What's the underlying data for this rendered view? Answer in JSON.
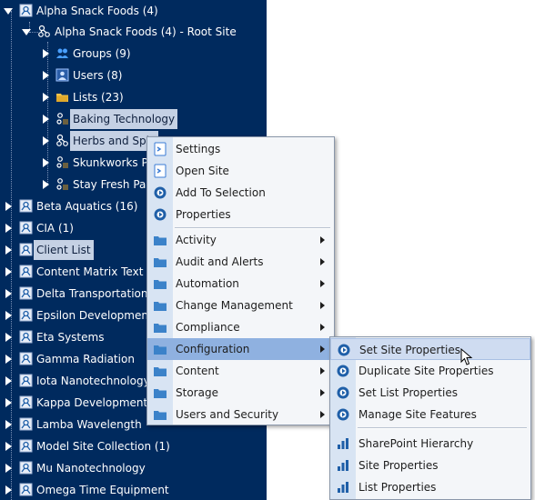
{
  "tree": {
    "items": [
      {
        "label": "Alpha Snack Foods (4)"
      },
      {
        "label": "Alpha Snack Foods (4) - Root Site"
      },
      {
        "label": "Groups (9)"
      },
      {
        "label": "Users (8)"
      },
      {
        "label": "Lists (23)"
      },
      {
        "label": "Baking Technology"
      },
      {
        "label": "Herbs and Spic"
      },
      {
        "label": "Skunkworks Pro"
      },
      {
        "label": "Stay Fresh Pacl"
      },
      {
        "label": "Beta Aquatics (16)"
      },
      {
        "label": "CIA (1)"
      },
      {
        "label": "Client List"
      },
      {
        "label": "Content Matrix Text"
      },
      {
        "label": "Delta Transportation"
      },
      {
        "label": "Epsilon Development"
      },
      {
        "label": "Eta Systems"
      },
      {
        "label": "Gamma Radiation"
      },
      {
        "label": "Iota Nanotechnology"
      },
      {
        "label": "Kappa Development"
      },
      {
        "label": "Lamba Wavelength"
      },
      {
        "label": "Model Site Collection (1)"
      },
      {
        "label": "Mu Nanotechnology"
      },
      {
        "label": "Omega Time Equipment"
      }
    ]
  },
  "context_menu": {
    "items": [
      {
        "label": "Settings"
      },
      {
        "label": "Open Site"
      },
      {
        "label": "Add To Selection"
      },
      {
        "label": "Properties"
      },
      {
        "label": "Activity"
      },
      {
        "label": "Audit and Alerts"
      },
      {
        "label": "Automation"
      },
      {
        "label": "Change Management"
      },
      {
        "label": "Compliance"
      },
      {
        "label": "Configuration"
      },
      {
        "label": "Content"
      },
      {
        "label": "Storage"
      },
      {
        "label": "Users and Security"
      }
    ]
  },
  "submenu": {
    "items": [
      {
        "label": "Set Site Properties"
      },
      {
        "label": "Duplicate Site Properties"
      },
      {
        "label": "Set List Properties"
      },
      {
        "label": "Manage Site Features"
      },
      {
        "label": "SharePoint Hierarchy"
      },
      {
        "label": "Site Properties"
      },
      {
        "label": "List Properties"
      }
    ]
  },
  "colors": {
    "tree_bg": "#002a5e",
    "selected_menu": "#8fb1e0",
    "hover_submenu": "#cfdcf1",
    "gear_blue": "#1f5fa8",
    "folder_blue": "#3b82c9"
  }
}
